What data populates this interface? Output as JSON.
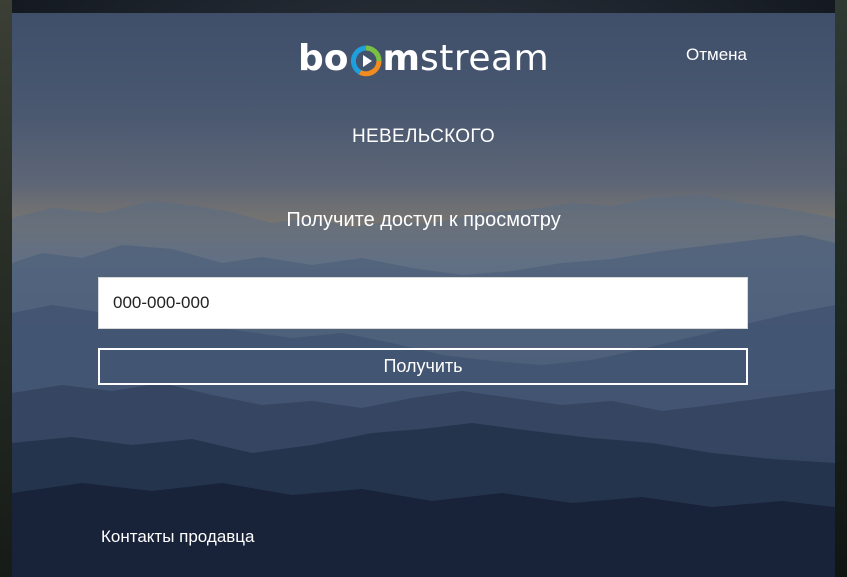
{
  "brand": {
    "logo_prefix": "bo",
    "logo_m": "m",
    "logo_suffix": "stream",
    "colors": {
      "ring_blue": "#1ea0dc",
      "ring_green": "#7cc043",
      "ring_orange": "#f28c1e",
      "play": "#ffffff"
    }
  },
  "header": {
    "cancel_label": "Отмена"
  },
  "channel": {
    "title": "НЕВЕЛЬСКОГО"
  },
  "form": {
    "headline": "Получите доступ к просмотру",
    "code_value": "000-000-000",
    "submit_label": "Получить"
  },
  "footer": {
    "seller_contacts_label": "Контакты продавца"
  }
}
